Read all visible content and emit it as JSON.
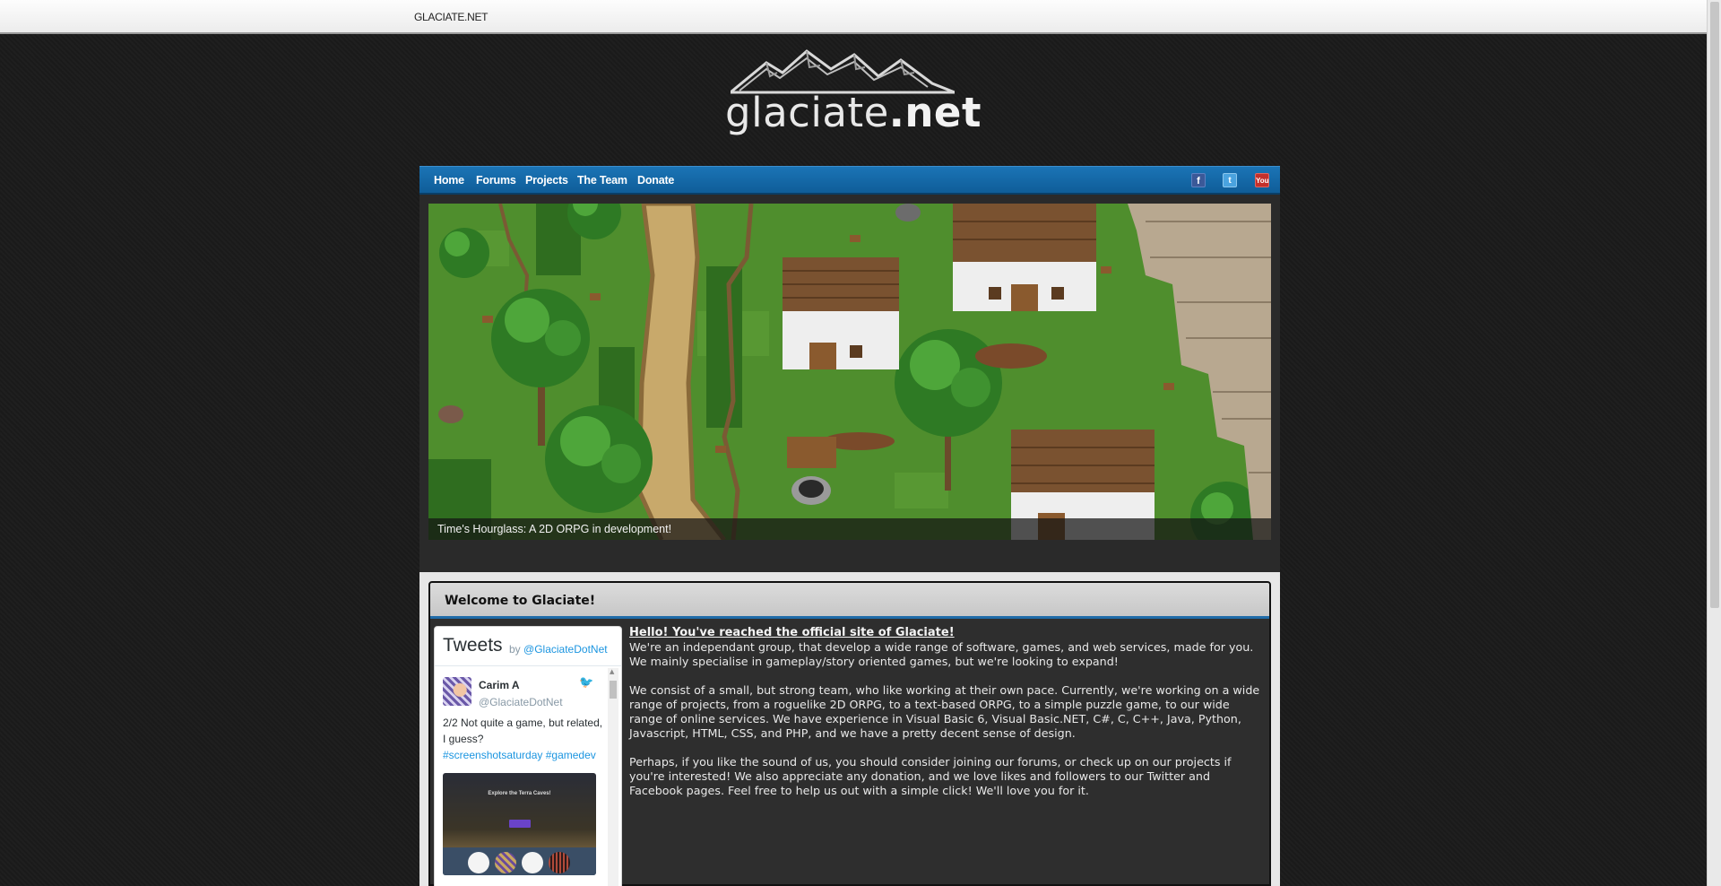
{
  "topbar": {
    "brand": "GLACIATE.NET"
  },
  "logo": {
    "text_light": "glaciate",
    "text_bold": ".net"
  },
  "nav": {
    "items": [
      {
        "label": "Home"
      },
      {
        "label": "Forums"
      },
      {
        "label": "Projects"
      },
      {
        "label": "The Team"
      },
      {
        "label": "Donate"
      }
    ],
    "social": [
      {
        "icon": "facebook-icon",
        "glyph": "f"
      },
      {
        "icon": "twitter-icon",
        "glyph": "t"
      },
      {
        "icon": "youtube-icon",
        "glyph": "You"
      }
    ]
  },
  "slider": {
    "caption": "Time's Hourglass: A 2D ORPG in development!",
    "slide_count": 2,
    "active_slide": 1,
    "prev_glyph": "‹",
    "next_glyph": "›"
  },
  "welcome": {
    "title": "Welcome to Glaciate!",
    "hello": "Hello! You've reached the official site of Glaciate!",
    "para1": "We're an independant group, that develop a wide range of software, games, and web services, made for you. We mainly specialise in gameplay/story oriented games, but we're looking to expand!",
    "para2": "We consist of a small, but strong team, who like working at their own pace. Currently, we're working on a wide range of projects, from a roguelike 2D ORPG, to a text-based ORPG, to a simple puzzle game, to our wide range of online services. We have experience in Visual Basic 6, Visual Basic.NET, C#, C, C++, Java, Python, Javascript, HTML, CSS, and PHP, and we have a pretty decent sense of design.",
    "para3": "Perhaps, if you like the sound of us, you should consider joining our forums, or check up on our projects if you're interested! We also appreciate any donation, and we love likes and followers to our Twitter and Facebook pages. Feel free to help us out with a simple click! We'll love you for it."
  },
  "tweets": {
    "title": "Tweets",
    "by": "by",
    "account": "@GlaciateDotNet",
    "tweet": {
      "name": "Carim A",
      "handle": "@GlaciateDotNet",
      "text": "2/2 Not quite a game, but related, I guess?",
      "hashtags": "#screenshotsaturday #gamedev",
      "media_title": "Explore the Terra Caves!"
    }
  },
  "colors": {
    "nav_blue": "#1b74b6",
    "accent_blue": "#1f6ba8",
    "twitter_link": "#1b95e0"
  }
}
